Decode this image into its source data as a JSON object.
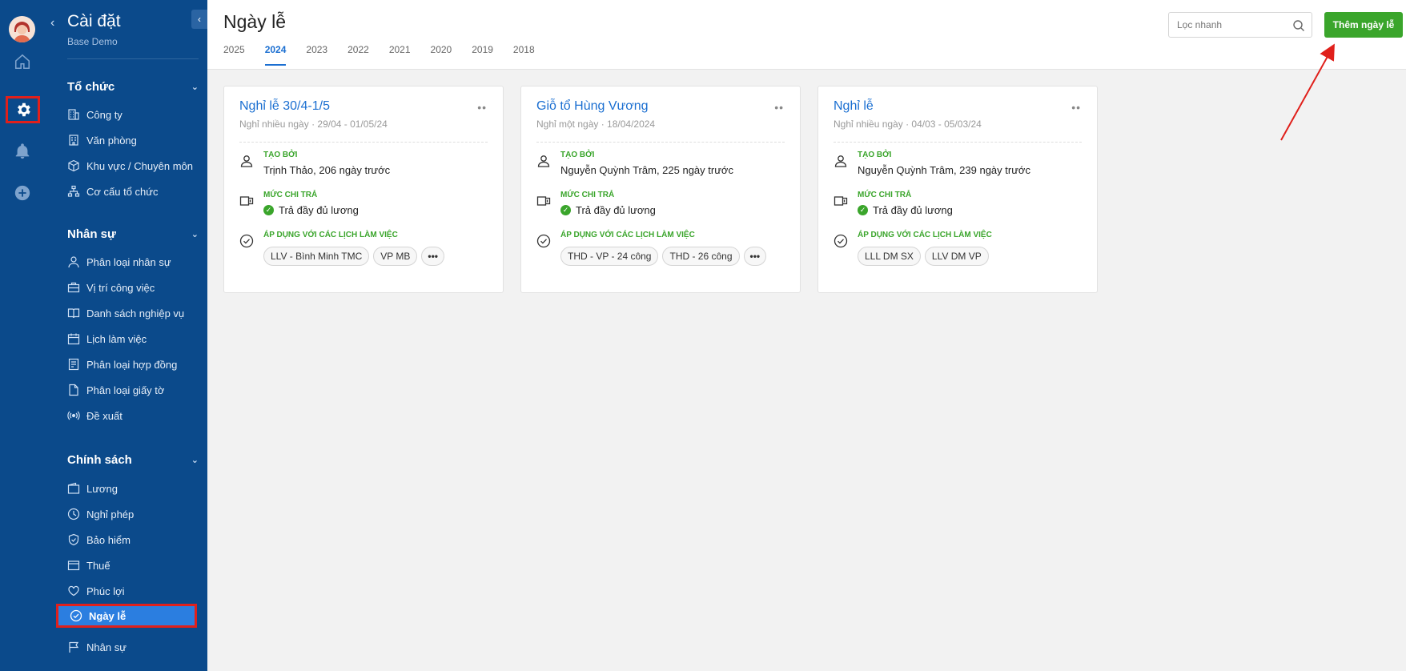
{
  "colors": {
    "sidebar": "#0b4a8b",
    "accent": "#1b6fd1",
    "green": "#3aa52b",
    "highlight": "#e0201b"
  },
  "rail": {
    "icons": [
      "avatar",
      "home-icon",
      "gear-icon",
      "bell-icon",
      "plus-circle-icon"
    ]
  },
  "sidebar": {
    "title": "Cài đặt",
    "subtitle": "Base Demo",
    "groups": [
      {
        "label": "Tổ chức",
        "items": [
          "Công ty",
          "Văn phòng",
          "Khu vực / Chuyên môn",
          "Cơ cấu tổ chức"
        ]
      },
      {
        "label": "Nhân sự",
        "items": [
          "Phân loại nhân sự",
          "Vị trí công việc",
          "Danh sách nghiệp vụ",
          "Lịch làm việc",
          "Phân loại hợp đồng",
          "Phân loại giấy tờ",
          "Đề xuất"
        ]
      },
      {
        "label": "Chính sách",
        "items": [
          "Lương",
          "Nghỉ phép",
          "Bảo hiểm",
          "Thuế",
          "Phúc lợi",
          "Ngày lễ",
          "Nhân sự"
        ]
      }
    ],
    "active": "Ngày lễ"
  },
  "header": {
    "title": "Ngày lễ",
    "years": [
      "2025",
      "2024",
      "2023",
      "2022",
      "2021",
      "2020",
      "2019",
      "2018"
    ],
    "active_year": "2024",
    "search_placeholder": "Lọc nhanh",
    "add_label": "Thêm ngày lễ"
  },
  "labels": {
    "created_by": "TẠO BỞI",
    "pay_rate": "MỨC CHI TRẢ",
    "applies_to": "ÁP DỤNG VỚI CÁC LỊCH LÀM VIỆC"
  },
  "cards": [
    {
      "title": "Nghỉ lễ 30/4-1/5",
      "subtitle": "Nghỉ nhiều ngày · 29/04 - 01/05/24",
      "created_by": "Trịnh Thảo, 206 ngày trước",
      "pay": "Trả đầy đủ lương",
      "schedules": [
        "LLV - Bình Minh TMC",
        "VP MB",
        "•••"
      ]
    },
    {
      "title": "Giỗ tổ Hùng Vương",
      "subtitle": "Nghỉ một ngày · 18/04/2024",
      "created_by": "Nguyễn Quỳnh Trâm, 225 ngày trước",
      "pay": "Trả đầy đủ lương",
      "schedules": [
        "THD - VP - 24 công",
        "THD - 26 công",
        "•••"
      ]
    },
    {
      "title": "Nghỉ lễ",
      "subtitle": "Nghỉ nhiều ngày · 04/03 - 05/03/24",
      "created_by": "Nguyễn Quỳnh Trâm, 239 ngày trước",
      "pay": "Trả đầy đủ lương",
      "schedules": [
        "LLL DM SX",
        "LLV DM VP"
      ]
    }
  ]
}
